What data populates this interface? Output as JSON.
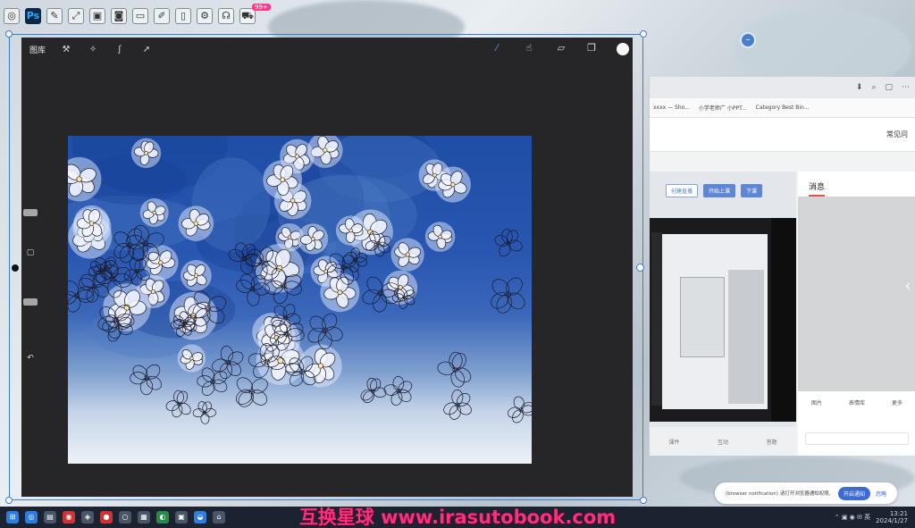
{
  "top_bar": {
    "icons": [
      "app-icon",
      "photoshop-icon",
      "brush-icon",
      "fullscreen-icon",
      "capture-icon",
      "camera-icon",
      "monitor-icon",
      "pen-icon",
      "tablet-icon",
      "settings-icon",
      "headset-icon",
      "cart-icon"
    ],
    "ps_label": "Ps",
    "badge": "99+"
  },
  "procreate": {
    "gallery_label": "图库",
    "left_tools": [
      "wrench-icon",
      "magic-wand-icon",
      "selection-icon",
      "transform-icon"
    ],
    "right_tools": [
      "brush-icon",
      "smudge-icon",
      "eraser-icon",
      "layers-icon",
      "color-icon"
    ],
    "active_tool": "brush-icon",
    "side_buttons": [
      "modify-icon",
      "undo-icon"
    ],
    "undo_glyph": "↶",
    "modify_glyph": "▢"
  },
  "browser": {
    "toolbar_icons": [
      "⬇",
      "⌕",
      "▢",
      "⋯"
    ],
    "bookmarks": [
      "xxxx — Sho...",
      "小学老师广 小PPT...",
      "Category Best Bin..."
    ],
    "header_right": "常见问",
    "buttons": [
      "创建直播",
      "开始上课",
      "下课"
    ],
    "nested_footer": [
      "课件",
      "互动",
      "答题"
    ],
    "messages_tab": "消息",
    "msg_tools": [
      "图片",
      "表情库",
      "更多"
    ]
  },
  "notification": {
    "text": "(browser notification) 请打开浏览器通知权限, 以便接收重要通知",
    "primary": "开启通知",
    "secondary": "忽略"
  },
  "taskbar": {
    "icons": [
      "start",
      "search",
      "files",
      "browser",
      "chat",
      "record",
      "dev",
      "ppt",
      "ps",
      "edge",
      "360",
      "music",
      "mail"
    ],
    "tray": "⌃ ▣ ◉ ✉ 英",
    "time": "13:21",
    "date": "2024/1/27"
  },
  "watermark": "互换星球 www.irasutobook.com",
  "colors": {
    "procreate_bg": "#262527",
    "accent": "#3a7bd5",
    "watermark": "#ff2f7d"
  }
}
